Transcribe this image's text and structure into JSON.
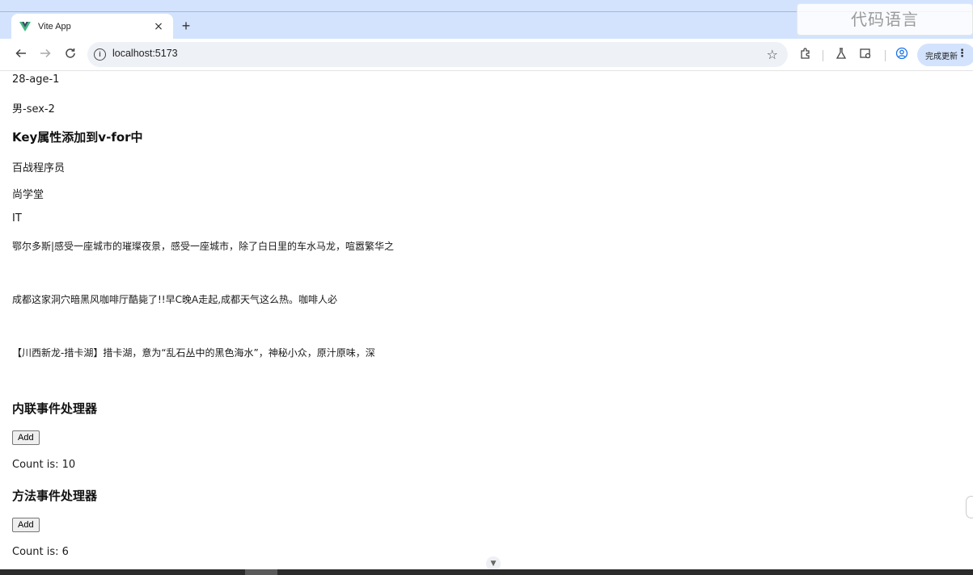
{
  "browser": {
    "tab_title": "Vite App",
    "tab_close": "×",
    "new_tab": "+",
    "url": "localhost:5173",
    "update_label": "完成更新",
    "watermark": "代码语言"
  },
  "page": {
    "lines_top": [
      "28-age-1",
      "男-sex-2"
    ],
    "section_key": "Key属性添加到v-for中",
    "list_items": [
      "百战程序员",
      "尚学堂",
      "IT"
    ],
    "articles": [
      "鄂尔多斯|感受一座城市的璀璨夜景，感受一座城市，除了白日里的车水马龙，喧嚣繁华之",
      "成都这家洞穴暗黑风咖啡厅酷毙了!!早C晚A走起,成都天气这么热。咖啡人必",
      "【川西新龙-措卡湖】措卡湖，意为“乱石丛中的黑色海水”，神秘小众，原汁原味，深"
    ],
    "inline_handler": {
      "heading": "内联事件处理器",
      "button_label": "Add",
      "count_text": "Count is: 10"
    },
    "method_handler": {
      "heading": "方法事件处理器",
      "button_label": "Add",
      "count_text": "Count is: 6"
    }
  },
  "colors": {
    "tabstrip": "#d3e3fd",
    "omnibox": "#eef1f6",
    "vue_green": "#42b883",
    "vue_dark": "#35495e"
  },
  "icons": [
    "vue-logo-icon",
    "close-icon",
    "plus-icon",
    "back-arrow-icon",
    "forward-arrow-icon",
    "reload-icon",
    "info-icon",
    "star-icon",
    "extensions-icon",
    "labs-flask-icon",
    "media-icon",
    "profile-icon",
    "more-vert-icon",
    "chevron-down-icon"
  ]
}
